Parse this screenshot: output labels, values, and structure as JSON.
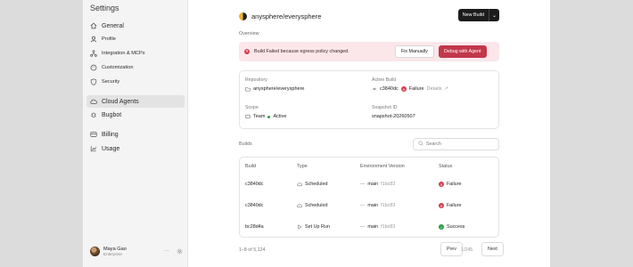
{
  "sidebar": {
    "title": "Settings",
    "items": [
      {
        "label": "General",
        "icon": "home-icon"
      },
      {
        "label": "Profile",
        "icon": "user-icon"
      },
      {
        "label": "Integration & MCPs",
        "icon": "integration-icon"
      },
      {
        "label": "Customization",
        "icon": "palette-icon"
      },
      {
        "label": "Security",
        "icon": "shield-icon"
      },
      {
        "label": "Cloud Agents",
        "icon": "cloud-icon"
      },
      {
        "label": "Bugbot",
        "icon": "bug-icon"
      },
      {
        "label": "Billing",
        "icon": "billing-icon"
      },
      {
        "label": "Usage",
        "icon": "chart-icon"
      }
    ],
    "user": {
      "name": "Maya Gao",
      "role": "Enterprise",
      "more": "···",
      "settings_icon": "gear-icon"
    }
  },
  "header": {
    "repo": "anysphere/everysphere",
    "new_build_label": "New Build",
    "caret": "⌄"
  },
  "overview": {
    "section_label": "Overview",
    "alert": {
      "message": "Build Failed because egress policy changed.",
      "fix_label": "Fix Manually",
      "debug_label": "Debug with Agent",
      "accent_color": "#c3374a"
    },
    "fields": {
      "repository_label": "Repository",
      "repository_value": "anysphere/everysphere",
      "active_build_label": "Active Build",
      "active_build_hash": "c3840dc",
      "active_build_status": "Failure",
      "details_label": "Details",
      "details_arrow": "↗",
      "scope_label": "Scope",
      "scope_value": "Team",
      "scope_status": "Active",
      "snapshot_label": "Snapshot ID",
      "snapshot_value": "snapshot-20260507"
    }
  },
  "builds": {
    "section_label": "Builds",
    "search_placeholder": "Search",
    "columns": [
      "Build",
      "Type",
      "Environment Version",
      "Status"
    ],
    "rows": [
      {
        "build": "c3840dc",
        "type": "Scheduled",
        "type_icon": "cloud-icon",
        "branch": "main",
        "commit": "f1bc83",
        "status": "Failure",
        "status_kind": "failure"
      },
      {
        "build": "c3840dc",
        "type": "Scheduled",
        "type_icon": "cloud-icon",
        "branch": "main",
        "commit": "f1bc83",
        "status": "Failure",
        "status_kind": "failure"
      },
      {
        "build": "bc28d4a",
        "type": "Set Up Run",
        "type_icon": "play-icon",
        "branch": "main",
        "commit": "f1bc83",
        "status": "Success",
        "status_kind": "success"
      }
    ],
    "pagination": {
      "range": "1–8 of 5,124",
      "prev_label": "Prev",
      "page": "1/245",
      "next_label": "Next"
    }
  }
}
